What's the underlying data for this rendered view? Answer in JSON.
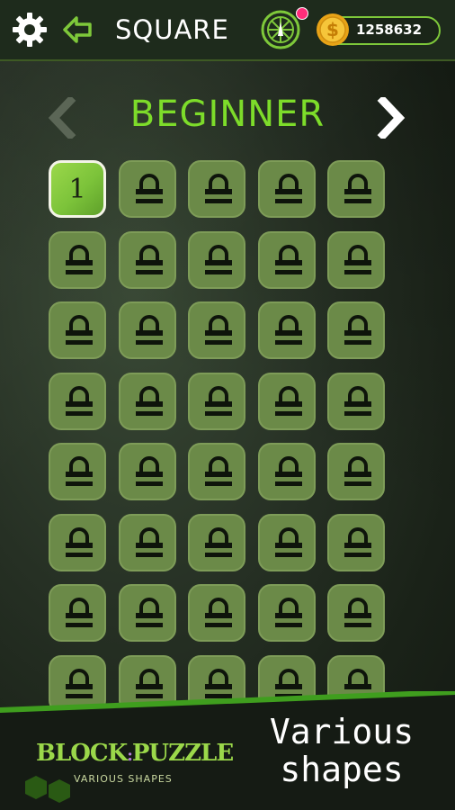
{
  "header": {
    "title": "SQUARE",
    "coins": "1258632",
    "settings_icon": "gear-icon",
    "back_icon": "arrow-left-icon",
    "wheel_icon": "lucky-wheel-icon",
    "coin_icon": "coin-icon",
    "notification_color": "#ff2d7a"
  },
  "level_selector": {
    "name": "BEGINNER",
    "prev_icon": "chevron-left-icon",
    "next_icon": "chevron-right-icon",
    "accent": "#7ddc2a"
  },
  "levels": {
    "unlocked_label": "1",
    "rows": 8,
    "cols": 5,
    "locked_icon": "lock-icon"
  },
  "banner": {
    "logo_left": "BLOCK",
    "logo_right": "PUZZLE",
    "logo_sub": "VARIOUS SHAPES",
    "tagline_line1": "Various",
    "tagline_line2": "shapes"
  },
  "colors": {
    "tile": "#6b8a48",
    "tile_unlocked": "#7cc33a",
    "bar_border": "#3e5a24"
  }
}
